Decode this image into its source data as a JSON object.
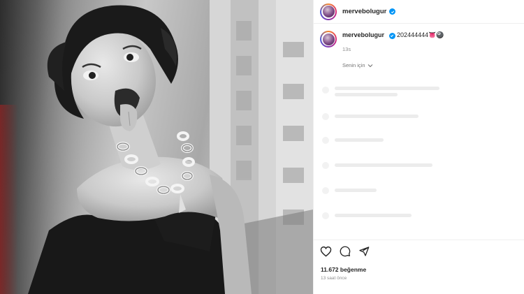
{
  "post": {
    "username": "mervebolugur",
    "caption_username": "mervebolugur",
    "caption_text": "202444444",
    "caption_emoji": "👅🎱",
    "caption_time": "13s",
    "see_all_label": "Senin için",
    "likes": "11.672 beğenme",
    "posted_ago": "13 saat önce"
  },
  "colors": {
    "verified": "#0095f6",
    "text": "#262626",
    "muted": "#8e8e8e"
  },
  "icons": {
    "like": "heart-icon",
    "comment": "comment-icon",
    "share": "share-icon",
    "verified": "verified-badge-icon",
    "expand": "chevron-down-icon"
  }
}
